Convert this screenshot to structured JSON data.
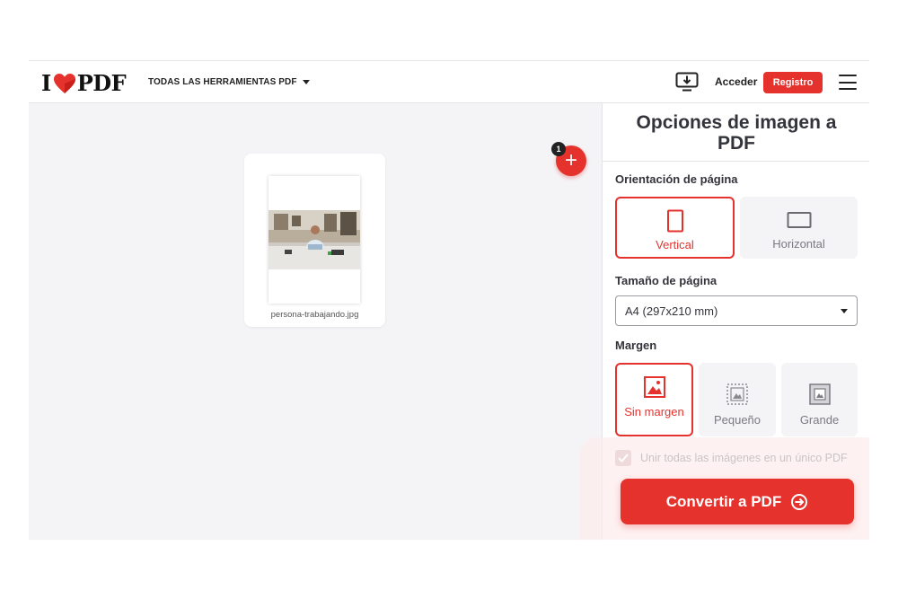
{
  "header": {
    "logo_left": "I",
    "logo_right": "PDF",
    "tools_label": "TODAS LAS HERRAMIENTAS PDF",
    "login_label": "Acceder",
    "register_label": "Registro"
  },
  "workspace": {
    "file_name": "persona-trabajando.jpg",
    "file_count_badge": "1"
  },
  "panel": {
    "title": "Opciones de imagen a PDF",
    "orientation": {
      "label": "Orientación de página",
      "options": [
        "Vertical",
        "Horizontal"
      ],
      "selected": "Vertical"
    },
    "page_size": {
      "label": "Tamaño de página",
      "value": "A4 (297x210 mm)"
    },
    "margin": {
      "label": "Margen",
      "options": [
        "Sin margen",
        "Pequeño",
        "Grande"
      ],
      "selected": "Sin margen"
    },
    "merge_label": "Unir todas las imágenes en un único PDF",
    "merge_checked": true,
    "convert_label": "Convertir a PDF"
  },
  "colors": {
    "accent": "#e5322d",
    "background": "#f4f4f7"
  },
  "icons": [
    "heart-icon",
    "caret-down-icon",
    "desktop-download-icon",
    "hamburger-menu-icon",
    "plus-icon",
    "portrait-page-icon",
    "landscape-page-icon",
    "no-margin-icon",
    "small-margin-icon",
    "large-margin-icon",
    "check-icon",
    "arrow-circle-right-icon"
  ]
}
